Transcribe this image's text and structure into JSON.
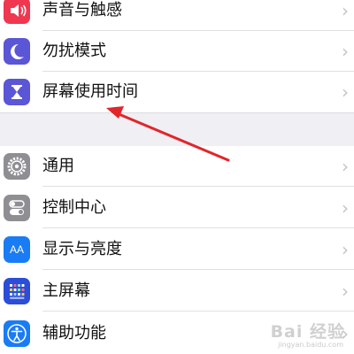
{
  "settings": {
    "items": [
      {
        "label": "声音与触感",
        "icon": "speaker-icon",
        "color": "#f0374f"
      },
      {
        "label": "勿扰模式",
        "icon": "moon-icon",
        "color": "#5a56d6"
      },
      {
        "label": "屏幕使用时间",
        "icon": "hourglass-icon",
        "color": "#5a56d6"
      },
      {
        "label": "通用",
        "icon": "gear-icon",
        "color": "#8e8e93"
      },
      {
        "label": "控制中心",
        "icon": "toggle-switches-icon",
        "color": "#8e8e93"
      },
      {
        "label": "显示与亮度",
        "icon": "aa-text-icon",
        "color": "#1a7cf5"
      },
      {
        "label": "主屏幕",
        "icon": "app-grid-icon",
        "color": "#2b4dd8"
      },
      {
        "label": "辅助功能",
        "icon": "accessibility-icon",
        "color": "#1a7cf5"
      }
    ],
    "chevron": "›",
    "aa_glyph": "AA"
  },
  "annotation": {
    "arrow_color": "#e0262b"
  },
  "watermark": {
    "main": "Bai 经验",
    "sub": "jingyan.baidu.com"
  }
}
